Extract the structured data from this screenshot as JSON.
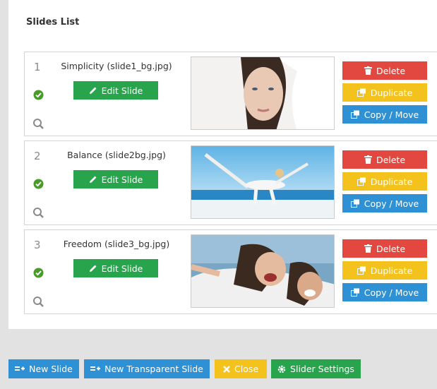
{
  "panel": {
    "title": "Slides List"
  },
  "slides": [
    {
      "num": "1",
      "name": "Simplicity (slide1_bg.jpg)",
      "edit_label": "Edit Slide"
    },
    {
      "num": "2",
      "name": "Balance (slide2bg.jpg)",
      "edit_label": "Edit Slide"
    },
    {
      "num": "3",
      "name": "Freedom (slide3_bg.jpg)",
      "edit_label": "Edit Slide"
    }
  ],
  "actions": {
    "delete": "Delete",
    "duplicate": "Duplicate",
    "copy_move": "Copy / Move"
  },
  "bottom": {
    "new_slide": "New Slide",
    "new_transparent": "New Transparent Slide",
    "close": "Close",
    "settings": "Slider Settings"
  },
  "colors": {
    "green": "#28a54c",
    "red": "#e2483f",
    "yellow": "#f4c21d",
    "blue": "#2e91d6"
  },
  "icons": [
    "check-circle-icon",
    "magnifier-icon",
    "pencil-icon",
    "trash-icon",
    "duplicate-icon",
    "copy-move-icon",
    "list-plus-icon",
    "close-x-icon",
    "gear-icon"
  ]
}
